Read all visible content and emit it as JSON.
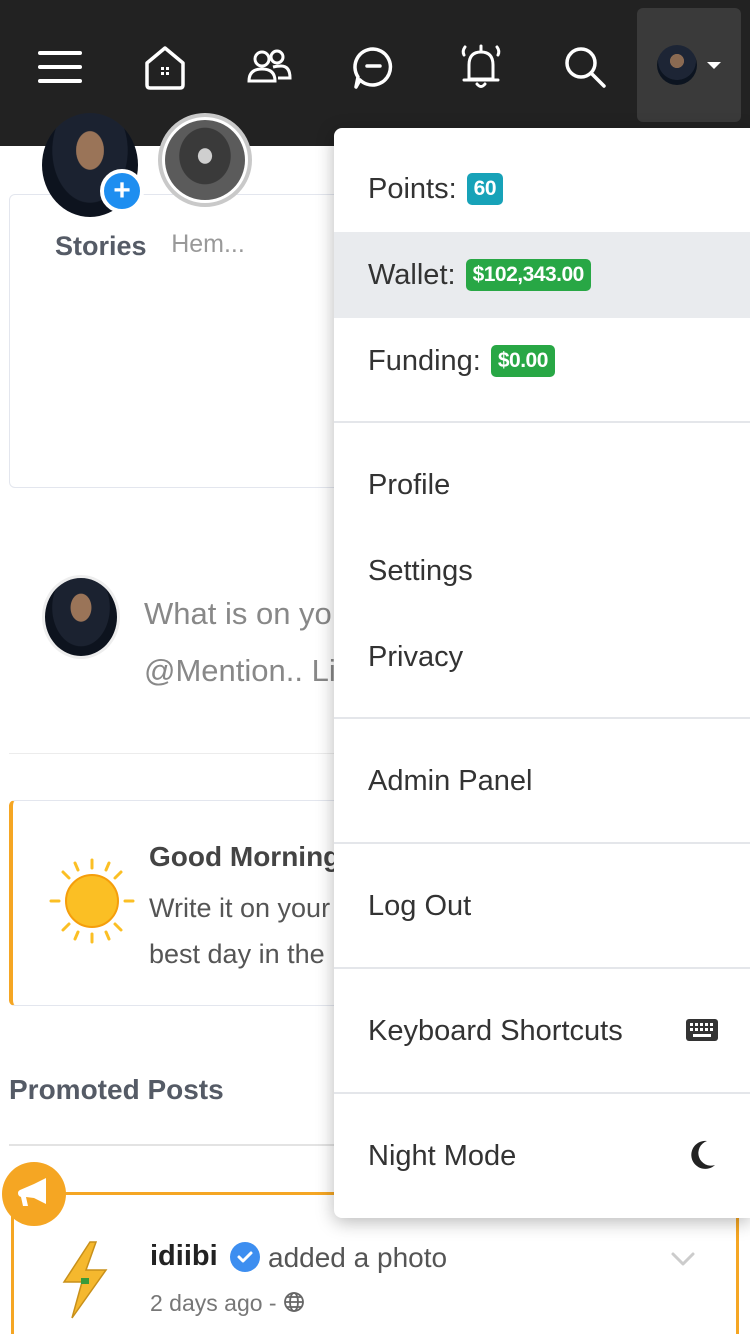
{
  "nav": {
    "icons": [
      "menu-icon",
      "home-icon",
      "friends-icon",
      "messages-icon",
      "notifications-icon",
      "search-icon",
      "avatar-caret"
    ]
  },
  "stories": {
    "title": "Stories",
    "items": [
      {
        "name": "",
        "type": "add-story"
      },
      {
        "name": "Hem..."
      }
    ]
  },
  "publisher": {
    "placeholder_line1": "What is on yo",
    "placeholder_line2": "@Mention.. Li"
  },
  "greeting": {
    "title": "Good Morning",
    "line1": "Write it on your",
    "line2": "best day in the"
  },
  "promoted": {
    "heading": "Promoted Posts",
    "post": {
      "author": "idiibi",
      "action": "added a photo",
      "time": "2 days ago -"
    }
  },
  "dropdown": {
    "points_label": "Points:",
    "points_value": "60",
    "wallet_label": "Wallet:",
    "wallet_value": "$102,343.00",
    "funding_label": "Funding:",
    "funding_value": "$0.00",
    "profile": "Profile",
    "settings": "Settings",
    "privacy": "Privacy",
    "admin_panel": "Admin Panel",
    "log_out": "Log Out",
    "keyboard_shortcuts": "Keyboard Shortcuts",
    "night_mode": "Night Mode"
  },
  "colors": {
    "topbar": "#222222",
    "accent_orange": "#f5a623",
    "badge_blue": "#17a2b8",
    "badge_green": "#28a745",
    "verified_blue": "#3d8ef0"
  }
}
